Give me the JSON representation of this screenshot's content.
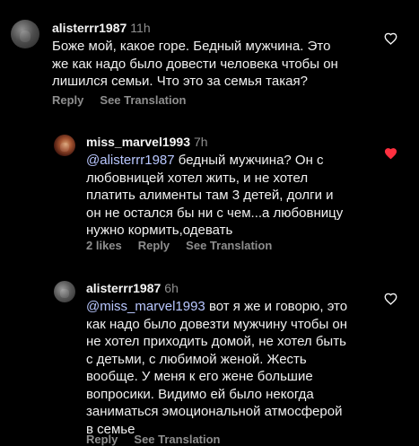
{
  "comments": [
    {
      "username": "alisterrr1987",
      "time": "11h",
      "mention": "",
      "text": "Боже мой, какое горе. Бедный мужчина. Это\nже как надо было довести человека чтобы он\nлишился семьи. Что это за семья такая?",
      "actions": {
        "likes": "",
        "reply": "Reply",
        "translate": "See Translation"
      },
      "liked": false,
      "icon": "heart-outline-icon"
    },
    {
      "username": "miss_marvel1993",
      "time": "7h",
      "mention": "@alisterrr1987",
      "text": " бедный мужчина? Он с\nлюбовницей хотел жить, и не хотел\nплатить алименты  там 3 детей, долги и\nон не остался бы ни с чем...а любовницу\nнужно кормить,одевать",
      "actions": {
        "likes": "2 likes",
        "reply": "Reply",
        "translate": "See Translation"
      },
      "liked": true,
      "icon": "heart-filled-icon"
    },
    {
      "username": "alisterrr1987",
      "time": "6h",
      "mention": "@miss_marvel1993",
      "text": " вот я же и говорю, это\nкак надо было довезти мужчину чтобы он\nне хотел приходить домой, не хотел быть\nс детьми, с любимой женой. Жесть\nвообще. У меня к его жене большие\nвопросики. Видимо ей было некогда\nзаниматься эмоциональной атмосферой\nв семье",
      "actions": {
        "likes": "",
        "reply": "Reply",
        "translate": "See Translation"
      },
      "liked": false,
      "icon": "heart-outline-icon"
    }
  ],
  "colors": {
    "background": "#000000",
    "text": "#f5f5f5",
    "muted": "#8e8e8e",
    "mention": "#b9c7ff",
    "like": "#ff3040"
  }
}
